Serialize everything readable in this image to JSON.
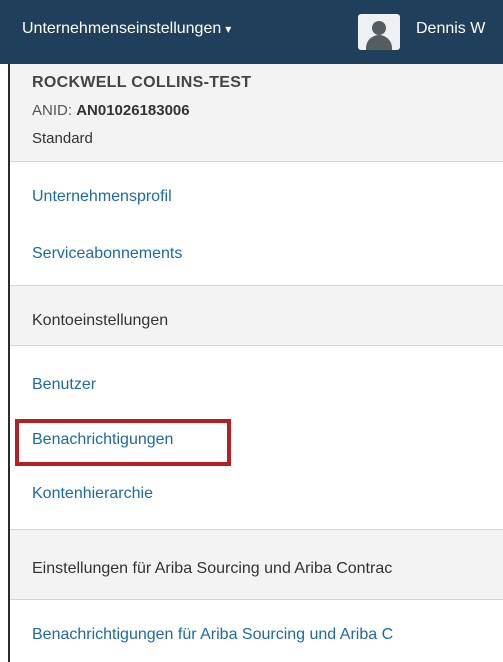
{
  "topbar": {
    "menu_label": "Unternehmenseinstellungen",
    "caret": "▾",
    "user_name": "Dennis W",
    "avatar_icon": "user-avatar-icon"
  },
  "account": {
    "company_name": "ROCKWELL COLLINS-TEST",
    "anid_label": "ANID:",
    "anid_value": "AN01026183006",
    "plan": "Standard"
  },
  "menu": {
    "links_group1": [
      "Unternehmensprofil",
      "Serviceabonnements"
    ],
    "section_account": "Kontoeinstellungen",
    "links_group2": [
      "Benutzer",
      "Benachrichtigungen",
      "Kontenhierarchie"
    ],
    "section_ariba": "Einstellungen für Ariba Sourcing und Ariba Contrac",
    "links_group3": [
      "Benachrichtigungen für Ariba Sourcing und Ariba C"
    ]
  },
  "colors": {
    "topbar_bg": "#1f3f5a",
    "link": "#1c6aa8",
    "highlight": "#b52025"
  }
}
